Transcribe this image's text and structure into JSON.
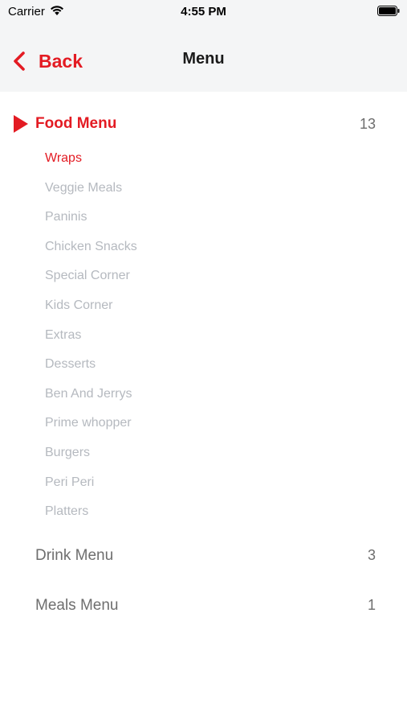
{
  "status": {
    "carrier": "Carrier",
    "time": "4:55 PM"
  },
  "nav": {
    "back_label": "Back",
    "title": "Menu"
  },
  "colors": {
    "accent": "#e31b23",
    "nav_bg": "#f4f5f6",
    "sub_item": "#b5b9bf",
    "category_text": "#6e6e6e"
  },
  "categories": [
    {
      "label": "Food Menu",
      "count": "13",
      "expanded": true,
      "icon": "play-icon",
      "items": [
        "Wraps",
        "Veggie Meals",
        "Paninis",
        "Chicken Snacks",
        "Special Corner",
        "Kids Corner",
        "Extras",
        "Desserts",
        "Ben And Jerrys",
        "Prime whopper",
        "Burgers",
        "Peri Peri",
        "Platters"
      ],
      "selected_item": "Wraps"
    },
    {
      "label": "Drink Menu",
      "count": "3",
      "expanded": false
    },
    {
      "label": "Meals Menu",
      "count": "1",
      "expanded": false
    }
  ]
}
